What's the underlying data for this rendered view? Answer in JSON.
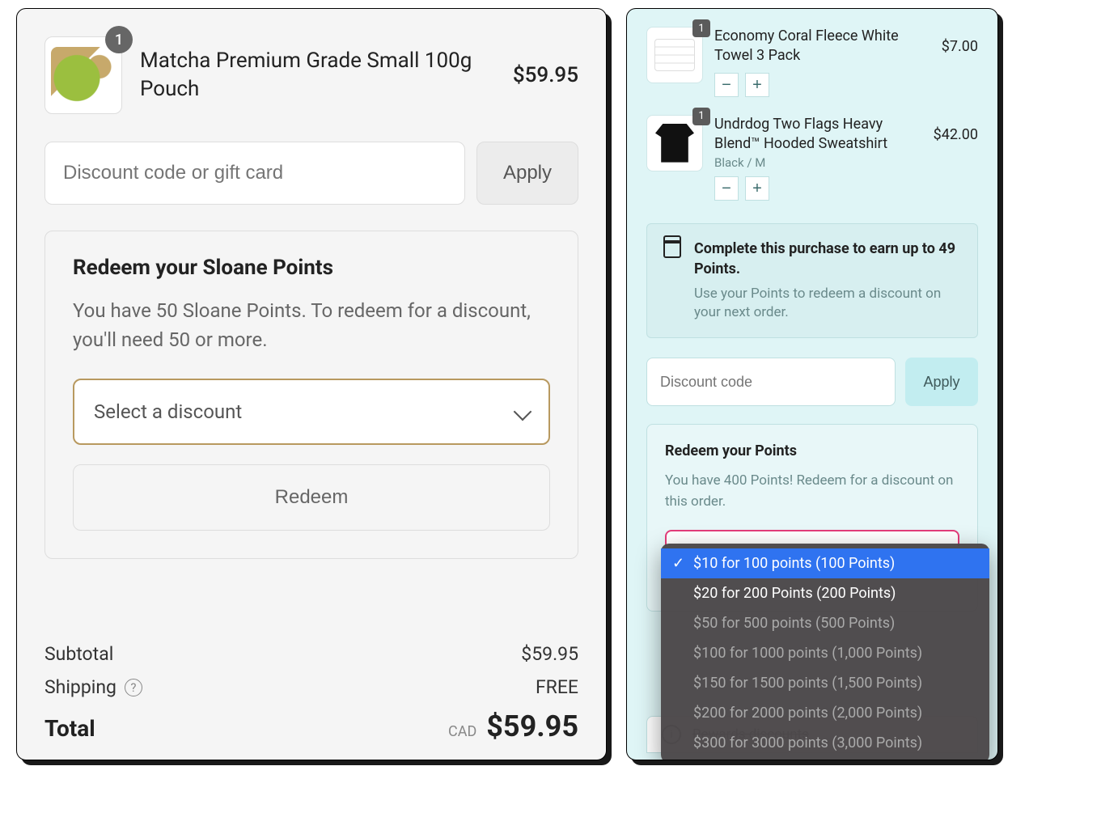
{
  "left": {
    "product": {
      "qty": "1",
      "title": "Matcha Premium Grade Small 100g Pouch",
      "price": "$59.95"
    },
    "discount": {
      "placeholder": "Discount code or gift card",
      "apply": "Apply"
    },
    "redeem": {
      "title": "Redeem your Sloane Points",
      "desc": "You have 50 Sloane Points. To redeem for a discount, you'll need 50 or more.",
      "select_placeholder": "Select a discount",
      "button": "Redeem"
    },
    "totals": {
      "subtotal_label": "Subtotal",
      "subtotal_value": "$59.95",
      "shipping_label": "Shipping",
      "shipping_value": "FREE",
      "total_label": "Total",
      "currency": "CAD",
      "total_value": "$59.95"
    }
  },
  "right": {
    "items": [
      {
        "qty": "1",
        "title": "Economy Coral Fleece White Towel 3 Pack",
        "variant": "",
        "price": "$7.00"
      },
      {
        "qty": "1",
        "title": "Undrdog Two Flags Heavy Blend™ Hooded Sweatshirt",
        "variant": "Black / M",
        "price": "$42.00"
      }
    ],
    "earn": {
      "title": "Complete this purchase to earn up to 49 Points.",
      "sub": "Use your Points to redeem a discount on your next order."
    },
    "discount": {
      "placeholder": "Discount code",
      "apply": "Apply"
    },
    "redeem": {
      "title": "Redeem your Points",
      "desc": "You have 400 Points! Redeem for a discount on this order."
    },
    "dropdown": [
      {
        "label": "$10 for 100 points (100 Points)",
        "selected": true,
        "disabled": false
      },
      {
        "label": "$20 for 200 Points (200 Points)",
        "selected": false,
        "disabled": false
      },
      {
        "label": "$50 for 500 points (500 Points)",
        "selected": false,
        "disabled": true
      },
      {
        "label": "$100 for 1000 points (1,000 Points)",
        "selected": false,
        "disabled": true
      },
      {
        "label": "$150 for 1500 points (1,500 Points)",
        "selected": false,
        "disabled": true
      },
      {
        "label": "$200 for 2000 points (2,000 Points)",
        "selected": false,
        "disabled": true
      },
      {
        "label": "$300 for 3000 points (3,000 Points)",
        "selected": false,
        "disabled": true
      }
    ],
    "rewards_peek": "Rewards discounts"
  }
}
